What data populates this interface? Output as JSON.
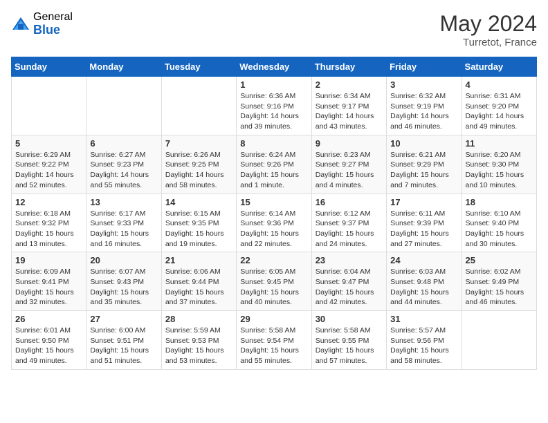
{
  "logo": {
    "general": "General",
    "blue": "Blue"
  },
  "title": "May 2024",
  "location": "Turretot, France",
  "days_of_week": [
    "Sunday",
    "Monday",
    "Tuesday",
    "Wednesday",
    "Thursday",
    "Friday",
    "Saturday"
  ],
  "weeks": [
    [
      {
        "day": "",
        "info": ""
      },
      {
        "day": "",
        "info": ""
      },
      {
        "day": "",
        "info": ""
      },
      {
        "day": "1",
        "info": "Sunrise: 6:36 AM\nSunset: 9:16 PM\nDaylight: 14 hours and 39 minutes."
      },
      {
        "day": "2",
        "info": "Sunrise: 6:34 AM\nSunset: 9:17 PM\nDaylight: 14 hours and 43 minutes."
      },
      {
        "day": "3",
        "info": "Sunrise: 6:32 AM\nSunset: 9:19 PM\nDaylight: 14 hours and 46 minutes."
      },
      {
        "day": "4",
        "info": "Sunrise: 6:31 AM\nSunset: 9:20 PM\nDaylight: 14 hours and 49 minutes."
      }
    ],
    [
      {
        "day": "5",
        "info": "Sunrise: 6:29 AM\nSunset: 9:22 PM\nDaylight: 14 hours and 52 minutes."
      },
      {
        "day": "6",
        "info": "Sunrise: 6:27 AM\nSunset: 9:23 PM\nDaylight: 14 hours and 55 minutes."
      },
      {
        "day": "7",
        "info": "Sunrise: 6:26 AM\nSunset: 9:25 PM\nDaylight: 14 hours and 58 minutes."
      },
      {
        "day": "8",
        "info": "Sunrise: 6:24 AM\nSunset: 9:26 PM\nDaylight: 15 hours and 1 minute."
      },
      {
        "day": "9",
        "info": "Sunrise: 6:23 AM\nSunset: 9:27 PM\nDaylight: 15 hours and 4 minutes."
      },
      {
        "day": "10",
        "info": "Sunrise: 6:21 AM\nSunset: 9:29 PM\nDaylight: 15 hours and 7 minutes."
      },
      {
        "day": "11",
        "info": "Sunrise: 6:20 AM\nSunset: 9:30 PM\nDaylight: 15 hours and 10 minutes."
      }
    ],
    [
      {
        "day": "12",
        "info": "Sunrise: 6:18 AM\nSunset: 9:32 PM\nDaylight: 15 hours and 13 minutes."
      },
      {
        "day": "13",
        "info": "Sunrise: 6:17 AM\nSunset: 9:33 PM\nDaylight: 15 hours and 16 minutes."
      },
      {
        "day": "14",
        "info": "Sunrise: 6:15 AM\nSunset: 9:35 PM\nDaylight: 15 hours and 19 minutes."
      },
      {
        "day": "15",
        "info": "Sunrise: 6:14 AM\nSunset: 9:36 PM\nDaylight: 15 hours and 22 minutes."
      },
      {
        "day": "16",
        "info": "Sunrise: 6:12 AM\nSunset: 9:37 PM\nDaylight: 15 hours and 24 minutes."
      },
      {
        "day": "17",
        "info": "Sunrise: 6:11 AM\nSunset: 9:39 PM\nDaylight: 15 hours and 27 minutes."
      },
      {
        "day": "18",
        "info": "Sunrise: 6:10 AM\nSunset: 9:40 PM\nDaylight: 15 hours and 30 minutes."
      }
    ],
    [
      {
        "day": "19",
        "info": "Sunrise: 6:09 AM\nSunset: 9:41 PM\nDaylight: 15 hours and 32 minutes."
      },
      {
        "day": "20",
        "info": "Sunrise: 6:07 AM\nSunset: 9:43 PM\nDaylight: 15 hours and 35 minutes."
      },
      {
        "day": "21",
        "info": "Sunrise: 6:06 AM\nSunset: 9:44 PM\nDaylight: 15 hours and 37 minutes."
      },
      {
        "day": "22",
        "info": "Sunrise: 6:05 AM\nSunset: 9:45 PM\nDaylight: 15 hours and 40 minutes."
      },
      {
        "day": "23",
        "info": "Sunrise: 6:04 AM\nSunset: 9:47 PM\nDaylight: 15 hours and 42 minutes."
      },
      {
        "day": "24",
        "info": "Sunrise: 6:03 AM\nSunset: 9:48 PM\nDaylight: 15 hours and 44 minutes."
      },
      {
        "day": "25",
        "info": "Sunrise: 6:02 AM\nSunset: 9:49 PM\nDaylight: 15 hours and 46 minutes."
      }
    ],
    [
      {
        "day": "26",
        "info": "Sunrise: 6:01 AM\nSunset: 9:50 PM\nDaylight: 15 hours and 49 minutes."
      },
      {
        "day": "27",
        "info": "Sunrise: 6:00 AM\nSunset: 9:51 PM\nDaylight: 15 hours and 51 minutes."
      },
      {
        "day": "28",
        "info": "Sunrise: 5:59 AM\nSunset: 9:53 PM\nDaylight: 15 hours and 53 minutes."
      },
      {
        "day": "29",
        "info": "Sunrise: 5:58 AM\nSunset: 9:54 PM\nDaylight: 15 hours and 55 minutes."
      },
      {
        "day": "30",
        "info": "Sunrise: 5:58 AM\nSunset: 9:55 PM\nDaylight: 15 hours and 57 minutes."
      },
      {
        "day": "31",
        "info": "Sunrise: 5:57 AM\nSunset: 9:56 PM\nDaylight: 15 hours and 58 minutes."
      },
      {
        "day": "",
        "info": ""
      }
    ]
  ]
}
